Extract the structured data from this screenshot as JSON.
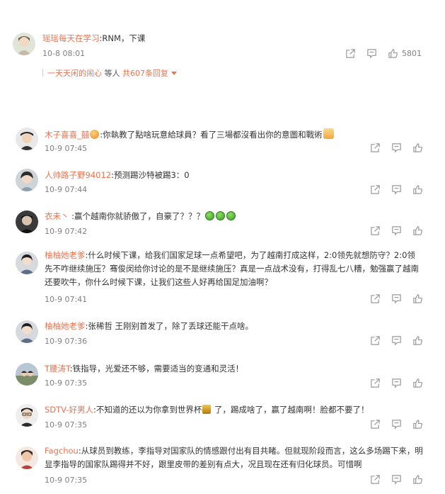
{
  "top_comment": {
    "username": "瑶瑶每天在学习",
    "text": ":RNM，下课",
    "time": "10-8 08:01",
    "likes": "5801",
    "replies_prefix": "一天天闲的闹心",
    "replies_mid": " 等人 ",
    "replies_more": "共607条回复"
  },
  "comments": [
    {
      "username": "木子喜喜_囍",
      "text": ":你執教了點啥玩意給球員？看了三場都沒看出你的意圖和戰術",
      "time": "10-9 07:45"
    },
    {
      "username": "人帅路子野94012",
      "text": ":预测踢沙特被踢3：0",
      "time": "10-9 07:44"
    },
    {
      "username": "衣未丶",
      "text": " :赢个越南你就骄傲了，自豪了？？？",
      "time": "10-9 07:42"
    },
    {
      "username": "柚柚她老爹",
      "text": ":什么时候下课，给我们国家足球一点希望吧，为了越南打成这样，2:0领先就想防守？2:0领先不咋继续施压？骞俊闵给你讨论的是不是继续施压？真是一点战术没有，打得乱七八糟，勉强赢了越南还要吹牛，你什么时候下课，让我们这些人好再给国足加油啊？",
      "time": "10-9 07:41"
    },
    {
      "username": "柚柚她老爹",
      "text": ":张稀哲 王刚别首发了，除了丢球还能干点啥。",
      "time": "10-9 07:36"
    },
    {
      "username": "T腰涛T",
      "text": ":铁指导，光爱还不够，需要适当的变通和灵活！",
      "time": "10-9 07:35"
    },
    {
      "username": "SDTV-好男人",
      "text": ":不知道的还以为你拿到世界杯",
      "text_after": " 了，踢成啥了，赢了越南啊！脸都不要了！",
      "time": "10-9 07:35"
    },
    {
      "username": "Fagchou",
      "text": ":从球员到教练，李指导对国家队的情感跟付出有目共睹。但就现阶段而言，这么多场踢下来，明显李指导的国家队踢得并不好，跟里皮带的差别有点大，况且现在还有归化球员。可惜啊",
      "time": "10-9 07:35"
    }
  ],
  "icons": {
    "share": "share-icon",
    "comment": "comment-icon",
    "like": "thumbs-up-icon"
  },
  "colors": {
    "username": "#eb7350",
    "text": "#333333",
    "time": "#808080"
  }
}
